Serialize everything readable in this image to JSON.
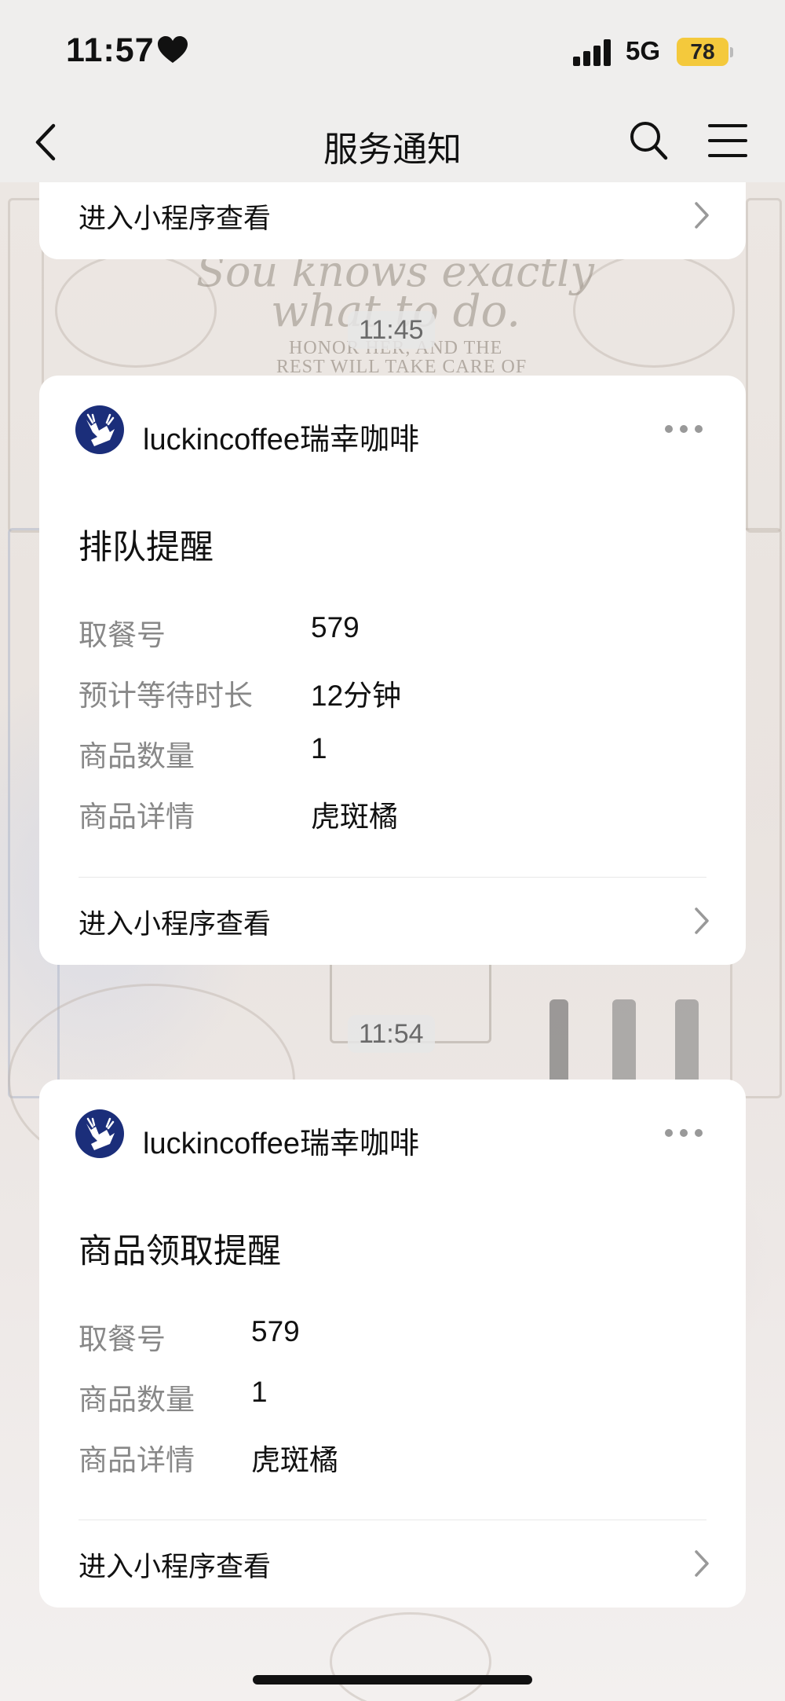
{
  "status_bar": {
    "time": "11:57",
    "network": "5G",
    "battery": "78"
  },
  "nav": {
    "title": "服务通知"
  },
  "top_card": {
    "link_label": "进入小程序查看"
  },
  "background": {
    "script_line1": "Sou knows exactly",
    "script_line2": "what to do.",
    "caps_line1": "HONOR HER, AND THE",
    "caps_line2": "REST WILL TAKE CARE OF"
  },
  "messages": [
    {
      "timestamp": "11:45",
      "brand": "luckincoffee瑞幸咖啡",
      "title": "排队提醒",
      "fields": [
        {
          "label": "取餐号",
          "value": "579"
        },
        {
          "label": "预计等待时长",
          "value": "12分钟"
        },
        {
          "label": "商品数量",
          "value": "1"
        },
        {
          "label": "商品详情",
          "value": "虎斑橘"
        }
      ],
      "link_label": "进入小程序查看"
    },
    {
      "timestamp": "11:54",
      "brand": "luckincoffee瑞幸咖啡",
      "title": "商品领取提醒",
      "fields": [
        {
          "label": "取餐号",
          "value": "579"
        },
        {
          "label": "商品数量",
          "value": "1"
        },
        {
          "label": "商品详情",
          "value": "虎斑橘"
        }
      ],
      "link_label": "进入小程序查看"
    }
  ],
  "colors": {
    "battery": "#f4c93c",
    "brand_avatar": "#1b2e7a",
    "label_gray": "#888888"
  }
}
